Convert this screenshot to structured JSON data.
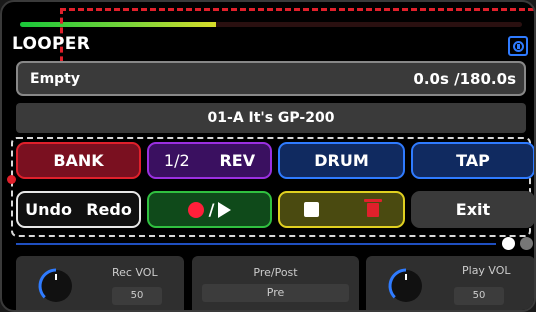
{
  "meter": {
    "level": 0.39
  },
  "header": {
    "title": "LOOPER",
    "icon": "looper-mode-icon"
  },
  "status": {
    "state": "Empty",
    "time": "0.0s /180.0s"
  },
  "preset": {
    "name": "01-A  It's GP-200"
  },
  "buttons": {
    "bank": "BANK",
    "half": "1/2",
    "rev": "REV",
    "drum": "DRUM",
    "tap": "TAP",
    "undo": "Undo",
    "redo": "Redo",
    "rec_play_slash": "/",
    "exit": "Exit"
  },
  "icons": {
    "record": "record-icon",
    "play": "play-icon",
    "stop": "stop-icon",
    "delete": "trash-icon"
  },
  "pagination": {
    "current": 1,
    "total": 2
  },
  "controls": {
    "rec_vol": {
      "label": "Rec VOL",
      "value": "50"
    },
    "pre_post": {
      "label": "Pre/Post",
      "value": "Pre"
    },
    "play_vol": {
      "label": "Play VOL",
      "value": "50"
    }
  },
  "colors": {
    "accent_red": "#e0202b",
    "accent_blue": "#2f7bff",
    "accent_purple": "#9a30e0",
    "accent_green": "#30c040",
    "accent_yellow": "#e0d020"
  }
}
